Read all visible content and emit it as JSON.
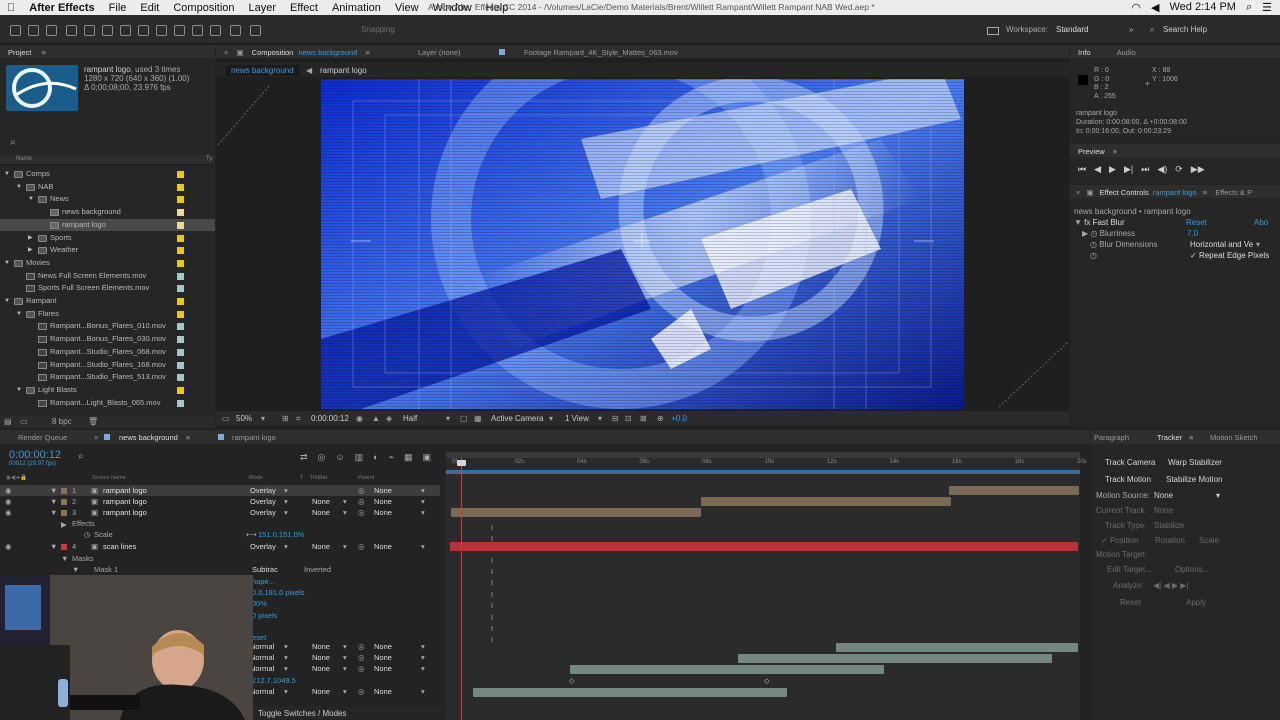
{
  "menubar": {
    "apple": "",
    "app": "After Effects",
    "items": [
      "File",
      "Edit",
      "Composition",
      "Layer",
      "Effect",
      "Animation",
      "View",
      "Window",
      "Help"
    ],
    "clock": "Wed 2:14 PM"
  },
  "title": "Adobe After Effects CC 2014 - /Volumes/LaCie/Demo Materials/Brent/Willett Rampant/Willett Rampant NAB Wed.aep *",
  "toolbar": {
    "snapping": "Snapping",
    "workspace_label": "Workspace:",
    "workspace": "Standard",
    "search": "Search Help"
  },
  "project": {
    "tab": "Project",
    "item_name": "rampant logo",
    "item_used": ", used 3 times",
    "item_dims": "1280 x 720  (640 x 360) (1.00)",
    "item_dur": "Δ 0;00;08;00, 23.976 fps",
    "col_name": "Name",
    "col_type": "Ty",
    "tree": [
      {
        "label": "Comps",
        "d": 0,
        "t": "folder",
        "x": "▼"
      },
      {
        "label": "NAB",
        "d": 1,
        "t": "folder",
        "x": "▼"
      },
      {
        "label": "News",
        "d": 2,
        "t": "folder",
        "x": "▼"
      },
      {
        "label": "news background",
        "d": 3,
        "t": "comp",
        "x": ""
      },
      {
        "label": "rampant logo",
        "d": 3,
        "t": "comp",
        "x": "",
        "sel": true
      },
      {
        "label": "Sports",
        "d": 2,
        "t": "folder",
        "x": "▶"
      },
      {
        "label": "Weather",
        "d": 2,
        "t": "folder",
        "x": "▶"
      },
      {
        "label": "Movies",
        "d": 0,
        "t": "folder",
        "x": "▼"
      },
      {
        "label": "News Full Screen Elements.mov",
        "d": 1,
        "t": "file",
        "x": ""
      },
      {
        "label": "Sports Full Screen Elements.mov",
        "d": 1,
        "t": "file",
        "x": ""
      },
      {
        "label": "Rampant",
        "d": 0,
        "t": "folder",
        "x": "▼"
      },
      {
        "label": "Flares",
        "d": 1,
        "t": "folder",
        "x": "▼"
      },
      {
        "label": "Rampant...Bonus_Flares_010.mov",
        "d": 2,
        "t": "file",
        "x": ""
      },
      {
        "label": "Rampant...Bonus_Flares_030.mov",
        "d": 2,
        "t": "file",
        "x": ""
      },
      {
        "label": "Rampant...Studio_Flares_068.mov",
        "d": 2,
        "t": "file",
        "x": ""
      },
      {
        "label": "Rampant...Studio_Flares_168.mov",
        "d": 2,
        "t": "file",
        "x": ""
      },
      {
        "label": "Rampant...Studio_Flares_513.mov",
        "d": 2,
        "t": "file",
        "x": ""
      },
      {
        "label": "Light Blasts",
        "d": 1,
        "t": "folder",
        "x": "▼"
      },
      {
        "label": "Rampant...Light_Blasts_065.mov",
        "d": 2,
        "t": "file",
        "x": ""
      }
    ],
    "bpc": "8 bpc"
  },
  "comp": {
    "tab": "Composition",
    "tab_name": "news background",
    "layer_tab": "Layer (none)",
    "footage_tab": "Footage Rampant_4K_Style_Mattes_063.mov",
    "crumb1": "news background",
    "crumb2": "rampant logo",
    "zoom": "50%",
    "time": "0:00:00:12",
    "res": "Half",
    "camera": "Active Camera",
    "views": "1 View",
    "exposure": "+0.0"
  },
  "info": {
    "tab": "Info",
    "tab2": "Audio",
    "r": "R : 0",
    "g": "G : 0",
    "b": "B : 2",
    "a": "A : 255",
    "x": "X : 88",
    "y": "Y : 1006",
    "name": "rampant logo",
    "dur": "Duration: 0:00:08:00, Δ +0:00:08:00",
    "inout": "In: 0:00:16:00, Out: 0:00:23:29"
  },
  "preview": {
    "tab": "Preview"
  },
  "effects": {
    "tab": "Effect Controls",
    "tab_layer": "rampant logo",
    "tab2": "Effects & P",
    "crumb": "news background • rampant logo",
    "fx_name": "Fast Blur",
    "reset": "Reset",
    "about": "Abo",
    "p1": "Blurriness",
    "p1v": "7.0",
    "p2": "Blur Dimensions",
    "p2v": "Horizontal and Ve",
    "p3": "Repeat Edge Pixels"
  },
  "timeline": {
    "tab1": "Render Queue",
    "tab2": "news background",
    "tab3": "rampant logo",
    "time": "0:00:00:12",
    "fps": "00012 (29.97 fps)",
    "col_source": "Source Name",
    "col_mode": "Mode",
    "col_trk": "TrkMat",
    "col_parent": "Parent",
    "ticks": [
      "0f",
      "02s",
      "04s",
      "06s",
      "08s",
      "10s",
      "12s",
      "14s",
      "16s",
      "18s",
      "20s"
    ],
    "layers": [
      {
        "n": "1",
        "name": "rampant logo",
        "mode": "Overlay",
        "trk": "",
        "parent": "None",
        "sel": true
      },
      {
        "n": "2",
        "name": "rampant logo",
        "mode": "Overlay",
        "trk": "None",
        "parent": "None"
      },
      {
        "n": "3",
        "name": "rampant logo",
        "mode": "Overlay",
        "trk": "None",
        "parent": "None"
      },
      {
        "n": "4",
        "name": "scan lines",
        "mode": "Overlay",
        "trk": "None",
        "parent": "None"
      }
    ],
    "effects_label": "Effects",
    "scale_label": "Scale",
    "scale_val": "151.0,151.0%",
    "masks_label": "Masks",
    "mask1": "Mask 1",
    "subtract": "Subtrac",
    "inverted": "Inverted",
    "partials": [
      "hape...",
      "0.0,181.0 pixels",
      "00%",
      "0 pixels",
      "eset"
    ],
    "lower_modes": [
      "Normal",
      "Normal",
      "Normal",
      "Normal"
    ],
    "lower_trk": "None",
    "lower_parent": "None",
    "lower_val": "212.7,1049.5",
    "toggle": "Toggle Switches / Modes"
  },
  "tracker": {
    "tab1": "Paragraph",
    "tab2": "Tracker",
    "tab3": "Motion Sketch",
    "track_camera": "Track Camera",
    "warp": "Warp Stabilizer",
    "track_motion": "Track Motion",
    "stab_motion": "Stabilize Motion",
    "motion_source": "Motion Source:",
    "ms_val": "None",
    "current_track": "Current Track:",
    "ct_val": "None",
    "track_type": "Track Type:",
    "tt_val": "Stabilize",
    "position": "Position",
    "rotation": "Rotation",
    "scale": "Scale",
    "motion_target": "Motion Target:",
    "edit_target": "Edit Target...",
    "options": "Options...",
    "analyze": "Analyze:",
    "reset": "Reset",
    "apply": "Apply"
  }
}
